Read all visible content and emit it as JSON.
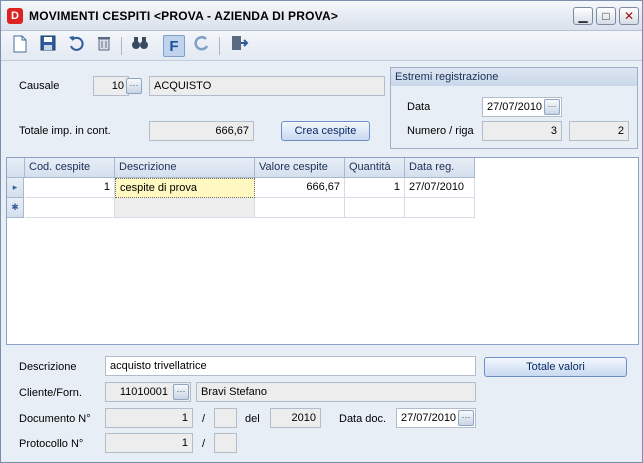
{
  "window": {
    "title": "MOVIMENTI CESPITI <PROVA - AZIENDA DI PROVA>",
    "app_icon_letter": "D"
  },
  "window_controls": {
    "minimize": "▁",
    "maximize": "□",
    "close": "✕"
  },
  "toolbar": {
    "icons": [
      "new-document-icon",
      "save-icon",
      "undo-icon",
      "delete-icon",
      "search-icon",
      "filter-icon",
      "refresh-icon",
      "exit-icon"
    ],
    "filter_label": "F"
  },
  "header": {
    "causale_label": "Causale",
    "causale_code": "10",
    "causale_desc": "ACQUISTO",
    "totale_label": "Totale imp. in cont.",
    "totale_value": "666,67",
    "crea_button": "Crea cespite"
  },
  "estremi": {
    "title": "Estremi registrazione",
    "data_label": "Data",
    "data_value": "27/07/2010",
    "numero_label": "Numero / riga",
    "numero_value": "3",
    "riga_value": "2"
  },
  "grid": {
    "columns": [
      "Cod. cespite",
      "Descrizione",
      "Valore cespite",
      "Quantità",
      "Data reg."
    ],
    "rows": [
      {
        "indicator": "▸",
        "cod": "1",
        "descrizione": "cespite di prova",
        "valore": "666,67",
        "quantita": "1",
        "data": "27/07/2010"
      }
    ],
    "new_row_indicator": "✱"
  },
  "footer": {
    "descrizione_label": "Descrizione",
    "descrizione_value": "acquisto trivellatrice",
    "totale_valori_button": "Totale valori",
    "cliente_label": "Cliente/Forn.",
    "cliente_code": "11010001",
    "cliente_name": "Bravi Stefano",
    "documento_label": "Documento N°",
    "documento_num": "1",
    "documento_suffix": "",
    "del_label": "del",
    "documento_anno": "2010",
    "data_doc_label": "Data doc.",
    "data_doc_value": "27/07/2010",
    "protocollo_label": "Protocollo N°",
    "protocollo_num": "1",
    "protocollo_suffix": "",
    "slash": "/"
  },
  "colors": {
    "accent": "#1F4E9A",
    "window_bg": "#E8EEF6",
    "selected_cell": "#FFF8C0"
  }
}
